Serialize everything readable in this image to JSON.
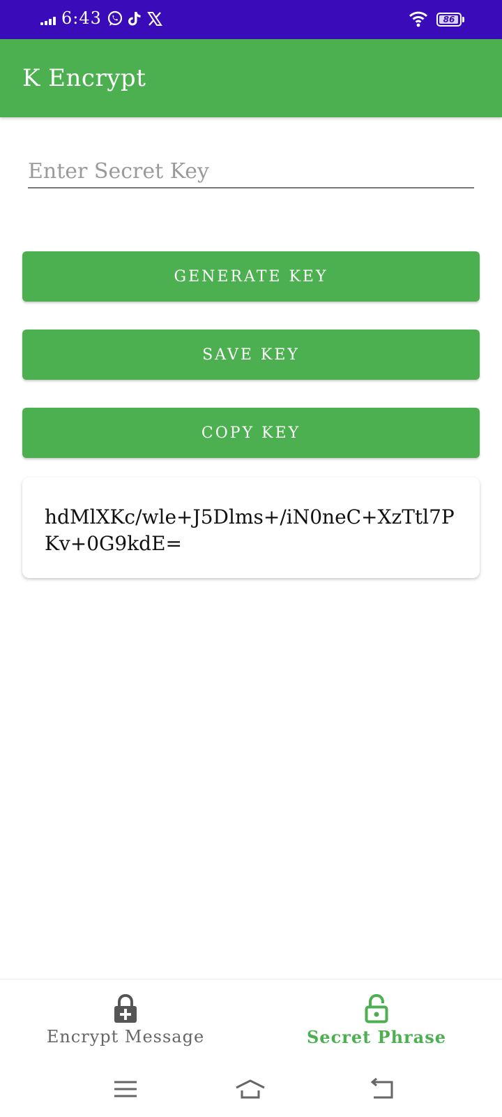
{
  "status_bar": {
    "time": "6:43",
    "battery": "86",
    "icons": [
      "signal-icon",
      "whatsapp-icon",
      "tiktok-icon",
      "x-icon",
      "wifi-icon",
      "battery-icon"
    ]
  },
  "app": {
    "title": "K Encrypt"
  },
  "secret_key_field": {
    "placeholder": "Enter Secret Key",
    "value": ""
  },
  "buttons": {
    "generate": "GENERATE KEY",
    "save": "SAVE KEY",
    "copy": "COPY KEY"
  },
  "generated_key": "hdMlXKc/wle+J5Dlms+/iN0neC+XzTtl7PKv+0G9kdE=",
  "bottom_nav": {
    "items": [
      {
        "label": "Encrypt Message",
        "icon": "lock-plus-icon",
        "active": false
      },
      {
        "label": "Secret Phrase",
        "icon": "lock-open-icon",
        "active": true
      }
    ]
  },
  "system_nav": [
    "menu-icon",
    "home-icon",
    "back-icon"
  ],
  "colors": {
    "status_bar": "#3a0bb8",
    "primary": "#4caf50",
    "inactive": "#666666"
  }
}
